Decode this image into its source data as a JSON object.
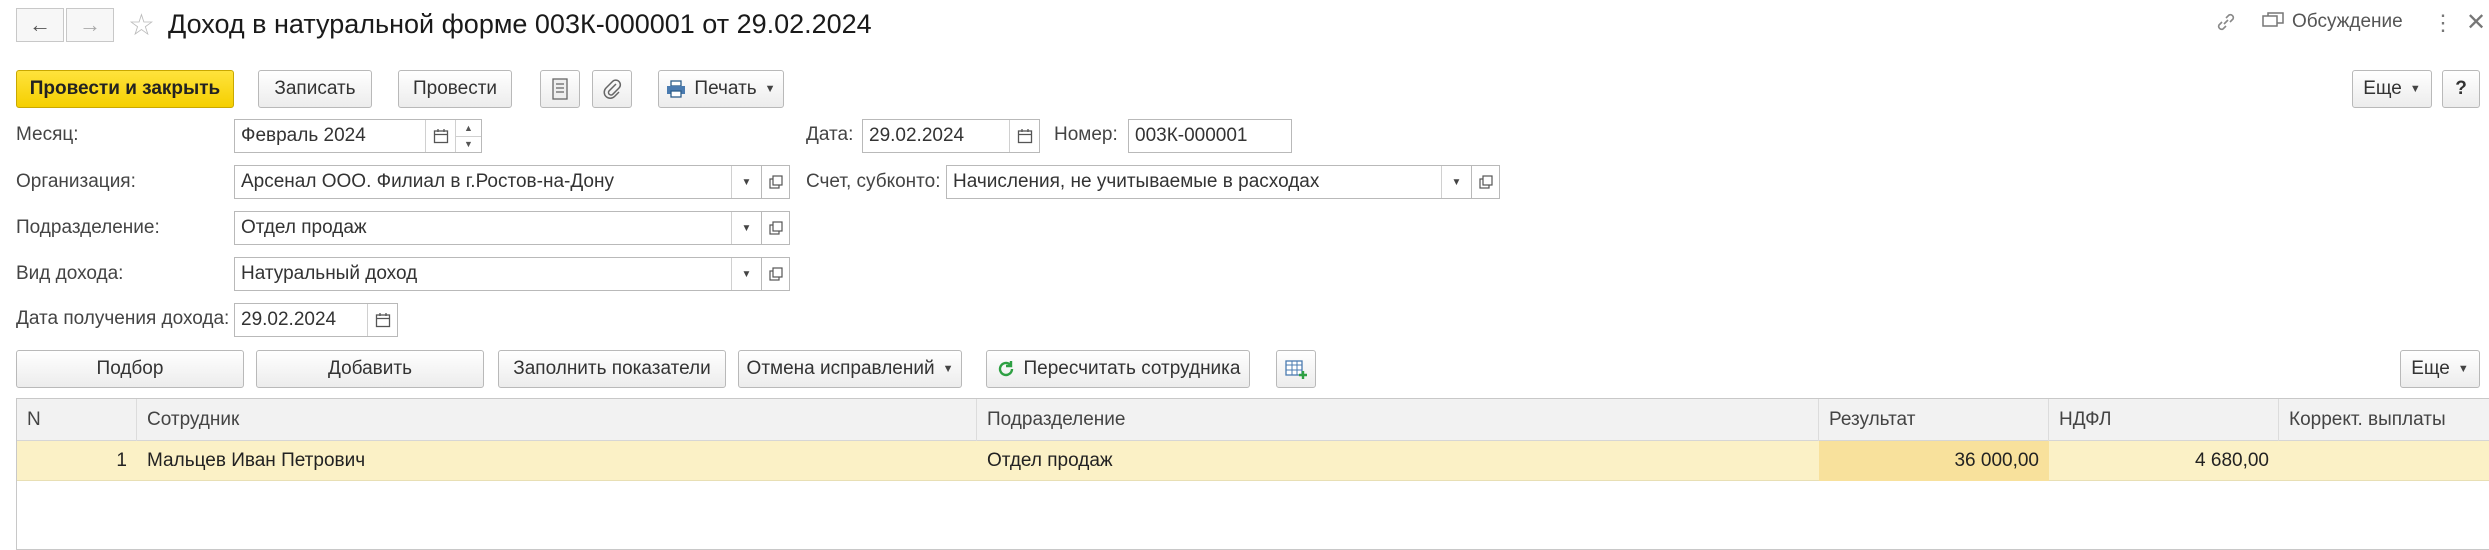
{
  "window": {
    "title": "Доход в натуральной форме 003К-000001 от 29.02.2024",
    "discuss_label": "Обсуждение"
  },
  "toolbar": {
    "post_close": "Провести и закрыть",
    "save": "Записать",
    "post": "Провести",
    "print": "Печать",
    "more": "Еще",
    "help": "?"
  },
  "form": {
    "month_label": "Месяц:",
    "month_value": "Февраль 2024",
    "date_label": "Дата:",
    "date_value": "29.02.2024",
    "number_label": "Номер:",
    "number_value": "003К-000001",
    "org_label": "Организация:",
    "org_value": "Арсенал ООО. Филиал в г.Ростов-на-Дону",
    "account_label": "Счет, субконто:",
    "account_value": "Начисления, не учитываемые в расходах",
    "dept_label": "Подразделение:",
    "dept_value": "Отдел продаж",
    "income_type_label": "Вид дохода:",
    "income_type_value": "Натуральный доход",
    "receipt_date_label": "Дата получения дохода:",
    "receipt_date_value": "29.02.2024"
  },
  "table_toolbar": {
    "pick": "Подбор",
    "add": "Добавить",
    "fill": "Заполнить показатели",
    "cancel_corrections": "Отмена исправлений",
    "recalc": "Пересчитать сотрудника",
    "more": "Еще"
  },
  "table": {
    "columns": [
      "N",
      "Сотрудник",
      "Подразделение",
      "Результат",
      "НДФЛ",
      "Коррект. выплаты"
    ],
    "rows": [
      {
        "n": "1",
        "employee": "Мальцев Иван Петрович",
        "dept": "Отдел продаж",
        "result": "36 000,00",
        "ndfl": "4 680,00",
        "correction": ""
      }
    ]
  },
  "colors": {
    "primary_button": "#f5cf00",
    "selected_row": "#fbf1c6",
    "highlight_cell": "#f8e19c",
    "recalc_icon": "#2ea043"
  }
}
